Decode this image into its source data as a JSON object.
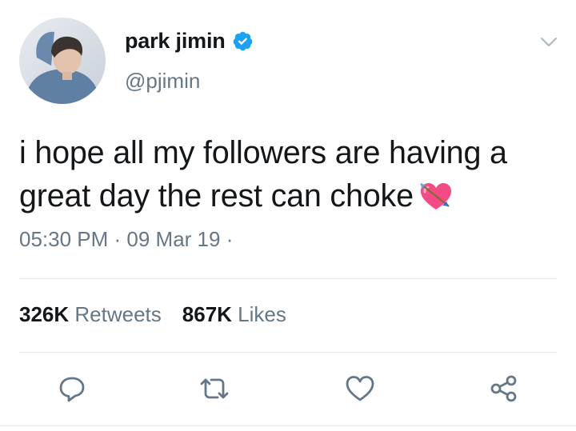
{
  "tweet": {
    "author": {
      "display_name": "park jimin",
      "handle": "@pjimin",
      "verified": true
    },
    "text": "i hope all my followers are having a great day the rest can choke",
    "emoji": "heart-with-arrow",
    "time": "05:30 PM",
    "date": "09 Mar 19",
    "separator": " · ",
    "stats": {
      "retweets_count": "326K",
      "retweets_label": "Retweets",
      "likes_count": "867K",
      "likes_label": "Likes"
    }
  },
  "colors": {
    "accent": "#1da1f2",
    "text": "#14171a",
    "muted": "#657786",
    "divider": "#e1e8ed"
  },
  "icons": [
    "reply-icon",
    "retweet-icon",
    "like-icon",
    "share-icon",
    "chevron-down-icon",
    "verified-badge-icon"
  ]
}
